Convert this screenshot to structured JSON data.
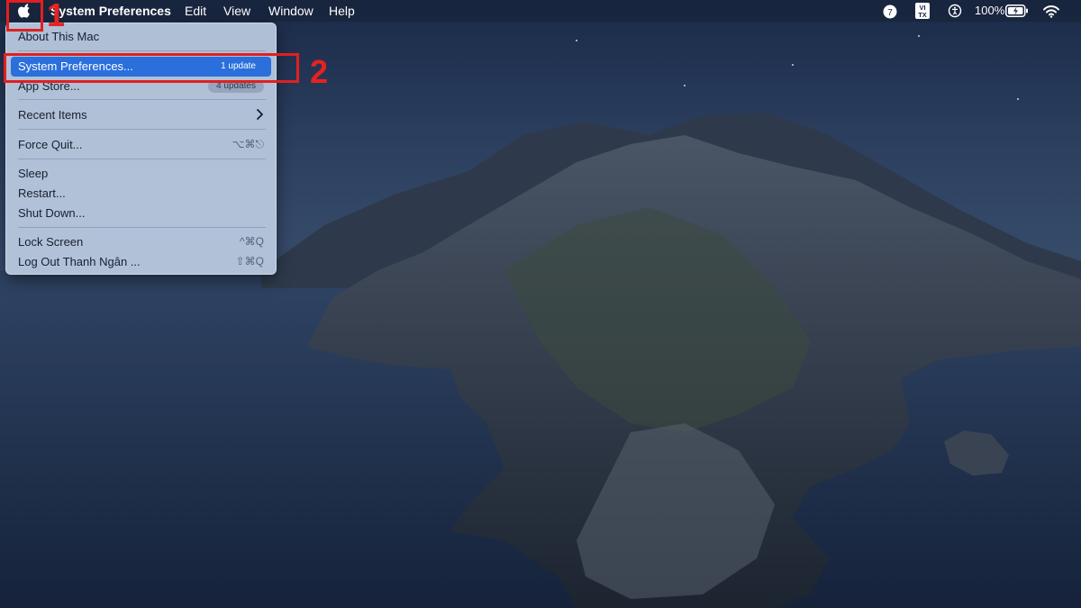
{
  "menubar": {
    "app_name": "System Preferences",
    "items": [
      "Edit",
      "View",
      "Window",
      "Help"
    ],
    "status": {
      "icons": [
        "notification-7-icon",
        "input-source-vi-tx-icon",
        "accessibility-icon",
        "battery-charging-icon",
        "wifi-icon"
      ],
      "notification_count": "7",
      "input_source_top": "VI",
      "input_source_bottom": "TX",
      "battery_text": "100%"
    }
  },
  "apple_menu": {
    "about": "About This Mac",
    "system_preferences": "System Preferences...",
    "system_preferences_badge": "1 update",
    "app_store": "App Store...",
    "app_store_badge": "4 updates",
    "recent_items": "Recent Items",
    "force_quit": "Force Quit...",
    "force_quit_shortcut": "⌥⌘⎋",
    "sleep": "Sleep",
    "restart": "Restart...",
    "shut_down": "Shut Down...",
    "lock_screen": "Lock Screen",
    "lock_screen_shortcut": "^⌘Q",
    "log_out": "Log Out Thanh Ngân ...",
    "log_out_shortcut": "⇧⌘Q"
  },
  "annotations": {
    "step1": "1",
    "step2": "2",
    "highlight_color": "#e02020"
  },
  "colors": {
    "selection": "#2a6fdb",
    "menu_bg": "#bccce2"
  }
}
